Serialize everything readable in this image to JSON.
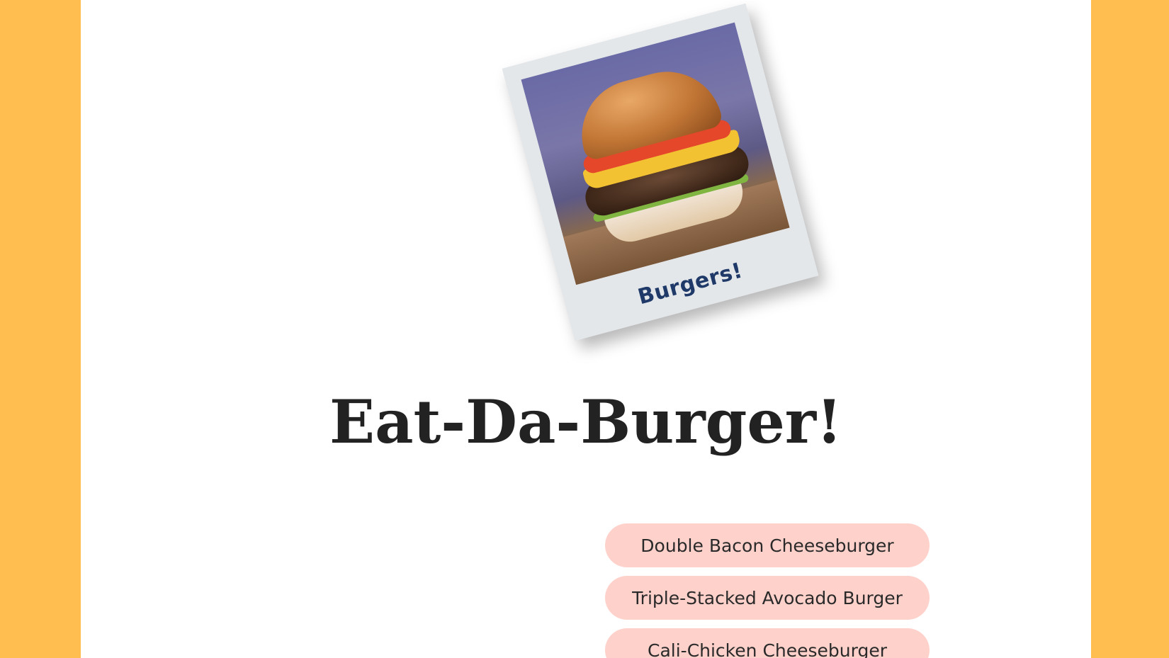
{
  "colors": {
    "background_accent": "#ffbe4f",
    "page_background": "#ffffff",
    "menu_button_background": "#ffd1cb",
    "caption_color": "#1f3a68",
    "title_color": "#222222"
  },
  "polaroid": {
    "caption": "Burgers!"
  },
  "header": {
    "title": "Eat-Da-Burger!"
  },
  "menu": {
    "items": [
      {
        "label": "Double Bacon Cheeseburger"
      },
      {
        "label": "Triple-Stacked Avocado Burger"
      },
      {
        "label": "Cali-Chicken Cheeseburger"
      }
    ]
  }
}
